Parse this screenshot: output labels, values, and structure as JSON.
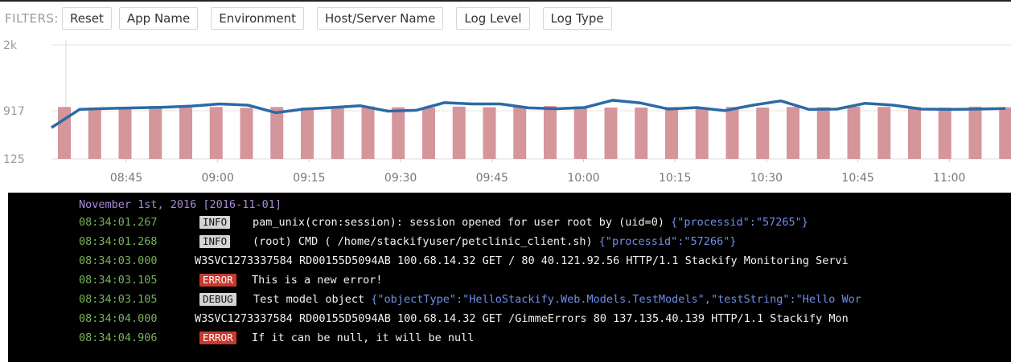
{
  "filters": {
    "label": "FILTERS:",
    "buttons": [
      "Reset",
      "App Name",
      "Environment",
      "Host/Server Name",
      "Log Level",
      "Log Type"
    ]
  },
  "chart_data": {
    "type": "bar",
    "y_ticks": [
      "2k",
      "917",
      "125"
    ],
    "x_ticks": [
      "08:45",
      "09:00",
      "09:15",
      "09:30",
      "09:45",
      "10:00",
      "10:15",
      "10:30",
      "10:45",
      "11:00"
    ],
    "bar_values": [
      980,
      970,
      975,
      995,
      970,
      980,
      965,
      980,
      970,
      980,
      990,
      975,
      970,
      985,
      975,
      980,
      995,
      990,
      970,
      970,
      980,
      975,
      980,
      970,
      980,
      975,
      985,
      980,
      980,
      970,
      985,
      975,
      970,
      970
    ],
    "line_values": [
      640,
      940,
      955,
      965,
      975,
      995,
      1030,
      1010,
      885,
      945,
      970,
      1000,
      910,
      925,
      1050,
      1030,
      1030,
      965,
      950,
      970,
      1090,
      1045,
      945,
      970,
      920,
      1010,
      1080,
      940,
      945,
      1040,
      1010,
      945,
      940,
      945,
      955
    ],
    "ylim": [
      125,
      2000
    ],
    "colors": {
      "bars": "#d4959b",
      "line": "#2c6aa6"
    }
  },
  "log": {
    "date_header": "November 1st, 2016 [2016-11-01]",
    "rows": [
      {
        "time": "08:34:01.267",
        "level": "INFO",
        "message": "pam_unix(cron:session): session opened for user root by (uid=0)",
        "json": "{\"processid\":\"57265\"}"
      },
      {
        "time": "08:34:01.268",
        "level": "INFO",
        "message": "(root) CMD (   /home/stackifyuser/petclinic_client.sh)",
        "json": "{\"processid\":\"57266\"}"
      },
      {
        "time": "08:34:03.000",
        "level": "",
        "message": "W3SVC1273337584 RD00155D5094AB 100.68.14.32 GET / 80 40.121.92.56 HTTP/1.1 Stackify Monitoring Servi",
        "json": ""
      },
      {
        "time": "08:34:03.105",
        "level": "ERROR",
        "message": "This is a new error!",
        "json": ""
      },
      {
        "time": "08:34:03.105",
        "level": "DEBUG",
        "message": "Test model object",
        "json": "{\"objectType\":\"HelloStackify.Web.Models.TestModels\",\"testString\":\"Hello Wor"
      },
      {
        "time": "08:34:04.000",
        "level": "",
        "message": "W3SVC1273337584 RD00155D5094AB 100.68.14.32 GET /GimmeErrors 80 137.135.40.139 HTTP/1.1 Stackify Mon",
        "json": ""
      },
      {
        "time": "08:34:04.906",
        "level": "ERROR",
        "message": "If it can be null, it will be null",
        "json": ""
      }
    ]
  }
}
